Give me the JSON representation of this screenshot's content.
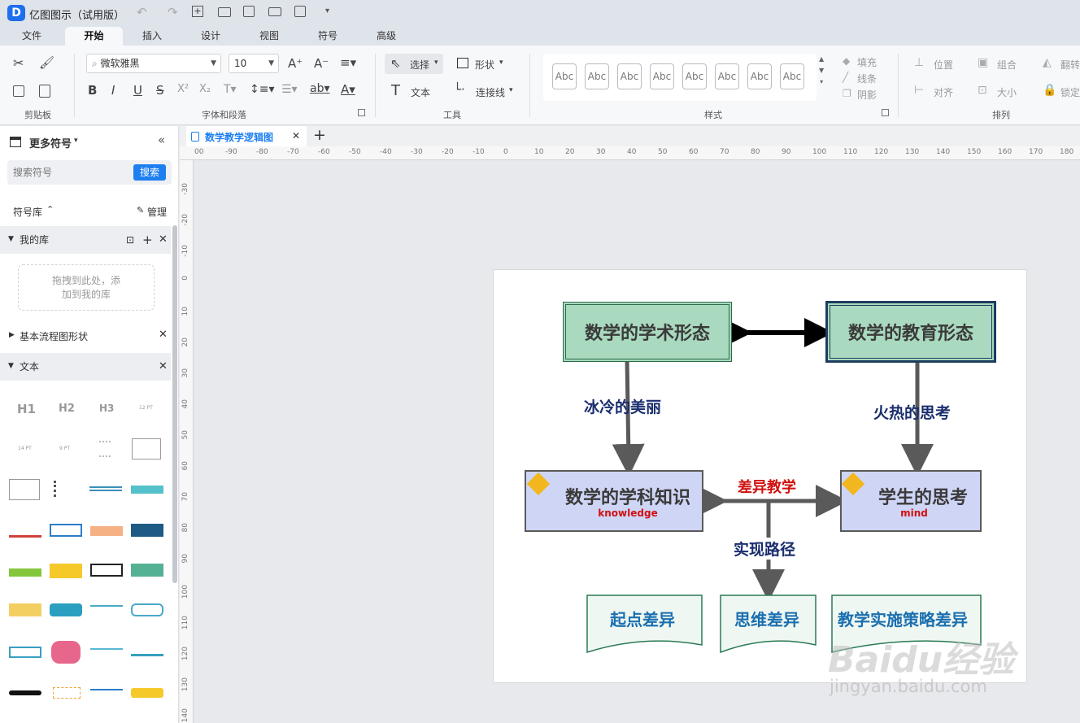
{
  "app": {
    "title": "亿图图示（试用版）",
    "brand_color": "#1e6ef0"
  },
  "menu_tabs": [
    "文件",
    "开始",
    "插入",
    "设计",
    "视图",
    "符号",
    "高级"
  ],
  "active_tab": "开始",
  "ribbon": {
    "groups": {
      "clipboard": "剪贴板",
      "font": "字体和段落",
      "tools": "工具",
      "style": "样式",
      "arrange": "排列"
    },
    "font_name": "微软雅黑",
    "font_size": "10",
    "select_label": "选择",
    "shape_label": "形状",
    "text_label": "文本",
    "connector_label": "连接线",
    "style_swatch": "Abc",
    "fill_label": "填充",
    "line_label": "线条",
    "shadow_label": "阴影",
    "position_label": "位置",
    "group_label": "组合",
    "flip_label": "翻转",
    "align_label": "对齐",
    "size_label": "大小",
    "lock_label": "锁定"
  },
  "left_panel": {
    "title": "更多符号",
    "search_placeholder": "搜索符号",
    "search_button": "搜索",
    "library_label": "符号库",
    "manage_label": "管理",
    "my_library": "我的库",
    "drop_hint_1": "拖拽到此处，添",
    "drop_hint_2": "加到我的库",
    "basic_flow": "基本流程图形状",
    "text_section": "文本",
    "text_samples": [
      "H1",
      "H2",
      "H3",
      "12 PT",
      "14 PT",
      "9 PT"
    ]
  },
  "document_tab": "数学教学逻辑图",
  "ruler": {
    "h_ticks": [
      "00",
      "-90",
      "-80",
      "-70",
      "-60",
      "-50",
      "-40",
      "-30",
      "-20",
      "-10",
      "0",
      "10",
      "20",
      "30",
      "40",
      "50",
      "60",
      "70",
      "80",
      "90",
      "100",
      "110",
      "120",
      "130",
      "140",
      "150",
      "160",
      "170",
      "180"
    ],
    "v_ticks": [
      "-30",
      "-20",
      "-10",
      "0",
      "10",
      "20",
      "30",
      "40",
      "50",
      "60",
      "70",
      "80",
      "90",
      "100",
      "110",
      "120",
      "130",
      "140"
    ]
  },
  "diagram": {
    "node_academic": "数学的学术形态",
    "node_education": "数学的教育形态",
    "label_cold": "冰冷的美丽",
    "label_hot": "火热的思考",
    "node_knowledge": "数学的学科知识",
    "node_knowledge_sub": "knowledge",
    "node_thinking": "学生的思考",
    "node_thinking_sub": "mind",
    "label_diff": "差异教学",
    "label_path": "实现路径",
    "doc_start": "起点差异",
    "doc_thinking": "思维差异",
    "doc_strategy": "教学实施策略差异",
    "colors": {
      "green_fill": "#a9d9be",
      "blue_fill": "#cfd5f5",
      "navy_text": "#1a2e6e",
      "red_text": "#d01010",
      "doc_text": "#1a6fb0",
      "diamond": "#f2b71f"
    }
  },
  "watermark": {
    "brand": "Baidu经验",
    "url": "jingyan.baidu.com"
  }
}
